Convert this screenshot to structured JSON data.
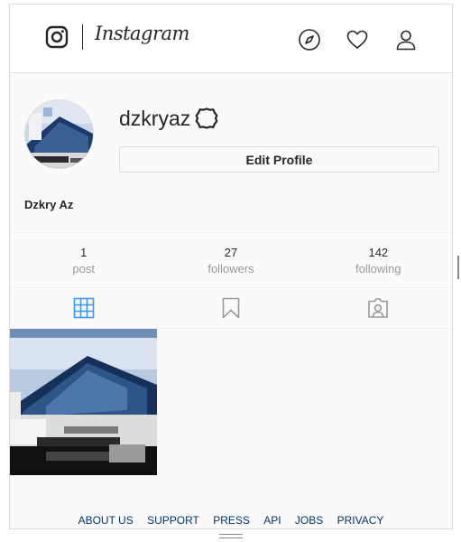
{
  "header": {
    "wordmark": "Instagram",
    "icons": [
      "instagram-camera-icon",
      "explore-compass-icon",
      "activity-heart-icon",
      "profile-person-icon"
    ]
  },
  "profile": {
    "username": "dzkryaz",
    "edit_label": "Edit Profile",
    "full_name": "Dzkry Az"
  },
  "stats": [
    {
      "value": "1",
      "label": "post"
    },
    {
      "value": "27",
      "label": "followers"
    },
    {
      "value": "142",
      "label": "following"
    }
  ],
  "tabs": [
    "grid-icon",
    "bookmark-icon",
    "tagged-portrait-icon"
  ],
  "colors": {
    "active_tab": "#3897f0",
    "inactive_icon": "#999999",
    "footer_link": "#003569",
    "text": "#262626",
    "muted": "#999999"
  },
  "footer": {
    "links": [
      "ABOUT US",
      "SUPPORT",
      "PRESS",
      "API",
      "JOBS",
      "PRIVACY"
    ]
  }
}
